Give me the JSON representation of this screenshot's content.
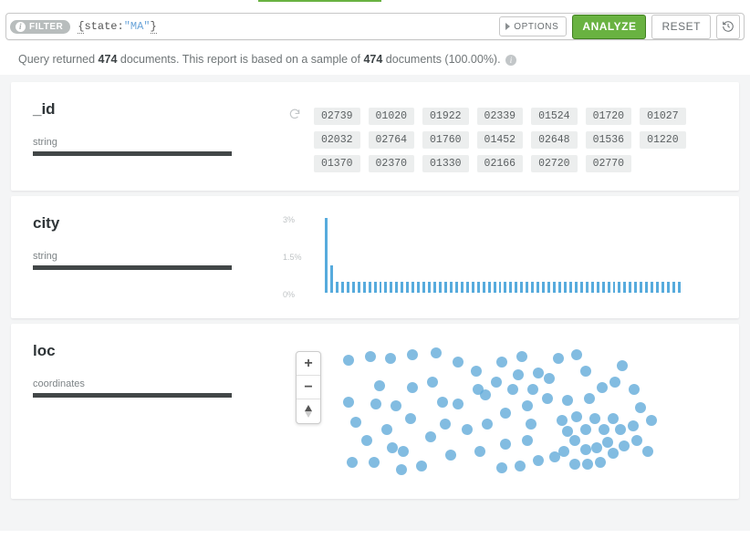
{
  "accent_color": "#69b241",
  "filterbar": {
    "chip_label": "FILTER",
    "query_open": "{",
    "query_key": "state",
    "query_colon": ":",
    "query_val": "\"MA\"",
    "query_close": "}",
    "options_label": "OPTIONS",
    "analyze_label": "ANALYZE",
    "reset_label": "RESET"
  },
  "summary": {
    "prefix": "Query returned ",
    "count": "474",
    "mid": " documents. This report is based on a sample of ",
    "sample": "474",
    "suffix": " documents (100.00%)."
  },
  "id_field": {
    "name": "_id",
    "type": "string",
    "chips": [
      "02739",
      "01020",
      "01922",
      "02339",
      "01524",
      "01720",
      "01027",
      "02032",
      "02764",
      "01760",
      "01452",
      "02648",
      "01536",
      "01220",
      "01370",
      "02370",
      "01330",
      "02166",
      "02720",
      "02770"
    ]
  },
  "city_field": {
    "name": "city",
    "type": "string"
  },
  "loc_field": {
    "name": "loc",
    "type": "coordinates"
  },
  "chart_data": {
    "type": "bar",
    "title": "",
    "xlabel": "",
    "ylabel": "",
    "ylim": [
      0,
      3
    ],
    "y_ticks": [
      "3%",
      "1.5%",
      "0%"
    ],
    "values": [
      3.0,
      1.1,
      0.45,
      0.45,
      0.45,
      0.45,
      0.45,
      0.45,
      0.45,
      0.45,
      0.45,
      0.45,
      0.45,
      0.45,
      0.45,
      0.45,
      0.45,
      0.45,
      0.45,
      0.45,
      0.45,
      0.45,
      0.45,
      0.45,
      0.45,
      0.45,
      0.45,
      0.45,
      0.45,
      0.45,
      0.45,
      0.45,
      0.45,
      0.45,
      0.45,
      0.45,
      0.45,
      0.45,
      0.45,
      0.45,
      0.45,
      0.45,
      0.45,
      0.45,
      0.45,
      0.45,
      0.45,
      0.45,
      0.45,
      0.45,
      0.45,
      0.45,
      0.45,
      0.45,
      0.45,
      0.45,
      0.45,
      0.45,
      0.45,
      0.45,
      0.45,
      0.45,
      0.45,
      0.45,
      0.45,
      0.45
    ]
  },
  "map_points": [
    [
      60,
      12
    ],
    [
      84,
      8
    ],
    [
      106,
      10
    ],
    [
      130,
      6
    ],
    [
      130,
      42
    ],
    [
      156,
      4
    ],
    [
      163,
      58
    ],
    [
      180,
      14
    ],
    [
      200,
      24
    ],
    [
      180,
      60
    ],
    [
      152,
      36
    ],
    [
      166,
      82
    ],
    [
      210,
      50
    ],
    [
      228,
      14
    ],
    [
      250,
      8
    ],
    [
      240,
      44
    ],
    [
      268,
      26
    ],
    [
      290,
      10
    ],
    [
      310,
      6
    ],
    [
      320,
      24
    ],
    [
      94,
      40
    ],
    [
      112,
      62
    ],
    [
      68,
      80
    ],
    [
      80,
      100
    ],
    [
      64,
      124
    ],
    [
      88,
      124
    ],
    [
      108,
      108
    ],
    [
      118,
      132
    ],
    [
      102,
      88
    ],
    [
      128,
      76
    ],
    [
      150,
      96
    ],
    [
      172,
      116
    ],
    [
      140,
      128
    ],
    [
      120,
      112
    ],
    [
      90,
      60
    ],
    [
      60,
      58
    ],
    [
      190,
      88
    ],
    [
      212,
      82
    ],
    [
      232,
      70
    ],
    [
      256,
      62
    ],
    [
      278,
      54
    ],
    [
      300,
      56
    ],
    [
      324,
      54
    ],
    [
      338,
      42
    ],
    [
      352,
      36
    ],
    [
      360,
      18
    ],
    [
      373,
      44
    ],
    [
      204,
      112
    ],
    [
      232,
      104
    ],
    [
      256,
      100
    ],
    [
      228,
      130
    ],
    [
      248,
      128
    ],
    [
      268,
      122
    ],
    [
      286,
      118
    ],
    [
      260,
      82
    ],
    [
      294,
      78
    ],
    [
      300,
      90
    ],
    [
      310,
      74
    ],
    [
      320,
      88
    ],
    [
      330,
      76
    ],
    [
      340,
      88
    ],
    [
      350,
      76
    ],
    [
      358,
      88
    ],
    [
      344,
      102
    ],
    [
      332,
      108
    ],
    [
      320,
      110
    ],
    [
      308,
      100
    ],
    [
      296,
      112
    ],
    [
      308,
      126
    ],
    [
      322,
      126
    ],
    [
      336,
      124
    ],
    [
      350,
      114
    ],
    [
      362,
      106
    ],
    [
      372,
      84
    ],
    [
      380,
      64
    ],
    [
      392,
      78
    ],
    [
      376,
      100
    ],
    [
      388,
      112
    ],
    [
      280,
      32
    ],
    [
      262,
      44
    ],
    [
      246,
      28
    ],
    [
      222,
      36
    ],
    [
      202,
      44
    ]
  ]
}
